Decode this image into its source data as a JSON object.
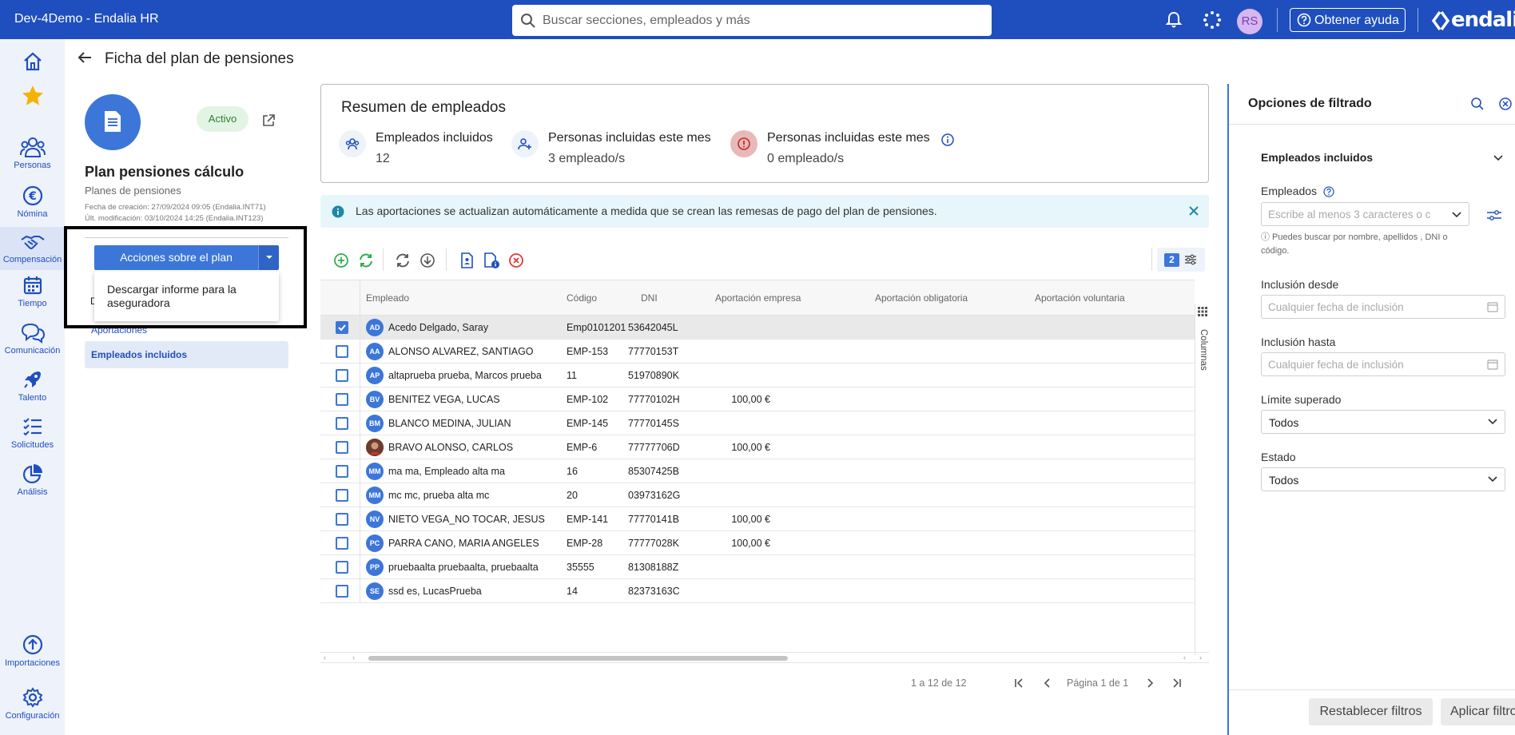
{
  "app": {
    "title": "Dev-4Demo - Endalia HR"
  },
  "search": {
    "placeholder": "Buscar secciones, empleados y más"
  },
  "topbar": {
    "avatar_initials": "RS",
    "help_label": "Obtener ayuda",
    "brand": "endalia"
  },
  "nav": {
    "items": [
      {
        "label": ""
      },
      {
        "label": ""
      },
      {
        "label": "Personas"
      },
      {
        "label": "Nómina"
      },
      {
        "label": "Compensación"
      },
      {
        "label": "Tiempo"
      },
      {
        "label": "Comunicación"
      },
      {
        "label": "Talento"
      },
      {
        "label": "Solicitudes"
      },
      {
        "label": "Análisis"
      },
      {
        "label": "Importaciones"
      },
      {
        "label": "Configuración"
      }
    ]
  },
  "page": {
    "title": "Ficha del plan de pensiones"
  },
  "plan": {
    "status": "Activo",
    "name": "Plan pensiones cálculo",
    "category": "Planes de pensiones",
    "created": "Fecha de creación: 27/09/2024 09:05 (Endalia.INT71)",
    "modified": "Últ. modificación: 03/10/2024 14:25 (Endalia.INT123)",
    "actions_label": "Acciones sobre el plan",
    "dropdown_item": "Descargar informe para la aseguradora",
    "dropdown_cut": "D",
    "subnav_aportaciones": "Aportaciones",
    "subnav_empleados": "Empleados incluidos"
  },
  "summary": {
    "title": "Resumen de empleados",
    "stats": [
      {
        "label": "Empleados incluidos",
        "value": "12"
      },
      {
        "label": "Personas incluidas este mes",
        "value": "3 empleado/s"
      },
      {
        "label": "Personas incluidas este mes",
        "value": "0 empleado/s"
      }
    ]
  },
  "banner": {
    "text": "Las aportaciones se actualizan automáticamente a medida que se crean las remesas de pago del plan de pensiones."
  },
  "toolbar": {
    "badge": "2"
  },
  "table": {
    "columns": [
      "Empleado",
      "Código",
      "DNI",
      "Aportación empresa",
      "Aportación obligatoria",
      "Aportación voluntaria"
    ],
    "side_label": "Columnas",
    "rows": [
      {
        "initials": "AD",
        "name": "Acedo Delgado, Saray",
        "code": "Emp0101201",
        "dni": "53642045L",
        "empresa": "",
        "selected": true
      },
      {
        "initials": "AA",
        "name": "ALONSO ALVAREZ, SANTIAGO",
        "code": "EMP-153",
        "dni": "77770153T",
        "empresa": ""
      },
      {
        "initials": "AP",
        "name": "altaprueba prueba, Marcos prueba",
        "code": "11",
        "dni": "51970890K",
        "empresa": ""
      },
      {
        "initials": "BV",
        "name": "BENITEZ VEGA, LUCAS",
        "code": "EMP-102",
        "dni": "77770102H",
        "empresa": "100,00 €"
      },
      {
        "initials": "BM",
        "name": "BLANCO MEDINA, JULIAN",
        "code": "EMP-145",
        "dni": "77770145S",
        "empresa": ""
      },
      {
        "initials": "",
        "name": "BRAVO ALONSO, CARLOS",
        "code": "EMP-6",
        "dni": "77777706D",
        "empresa": "100,00 €",
        "photo": true
      },
      {
        "initials": "MM",
        "name": "ma ma, Empleado alta ma",
        "code": "16",
        "dni": "85307425B",
        "empresa": ""
      },
      {
        "initials": "MM",
        "name": "mc mc, prueba alta mc",
        "code": "20",
        "dni": "03973162G",
        "empresa": ""
      },
      {
        "initials": "NV",
        "name": "NIETO VEGA_NO TOCAR, JESUS",
        "code": "EMP-141",
        "dni": "77770141B",
        "empresa": "100,00 €"
      },
      {
        "initials": "PC",
        "name": "PARRA CANO, MARIA ANGELES",
        "code": "EMP-28",
        "dni": "77777028K",
        "empresa": "100,00 €"
      },
      {
        "initials": "PP",
        "name": "pruebaalta pruebaalta, pruebaalta",
        "code": "35555",
        "dni": "81308188Z",
        "empresa": ""
      },
      {
        "initials": "SE",
        "name": "ssd es, LucasPrueba",
        "code": "14",
        "dni": "82373163C",
        "empresa": ""
      }
    ]
  },
  "pagination": {
    "range": "1 a 12 de 12",
    "page": "Página 1 de 1"
  },
  "filters": {
    "title": "Opciones de filtrado",
    "section": "Empleados incluidos",
    "empleados_label": "Empleados",
    "empleados_placeholder": "Escribe al menos 3 caracteres o c",
    "hint": "ⓘ Puedes buscar por nombre, apellidos , DNI o código.",
    "desde_label": "Inclusión desde",
    "desde_placeholder": "Cualquier fecha de inclusión",
    "hasta_label": "Inclusión hasta",
    "hasta_placeholder": "Cualquier fecha de inclusión",
    "limite_label": "Límite superado",
    "limite_value": "Todos",
    "estado_label": "Estado",
    "estado_value": "Todos",
    "reset_label": "Restablecer filtros",
    "apply_label": "Aplicar filtros"
  },
  "colors": {
    "primary": "#1f4fbf",
    "accent": "#3c76d8",
    "active_green": "#2e7d32",
    "banner_bg": "#e7f6fb"
  }
}
